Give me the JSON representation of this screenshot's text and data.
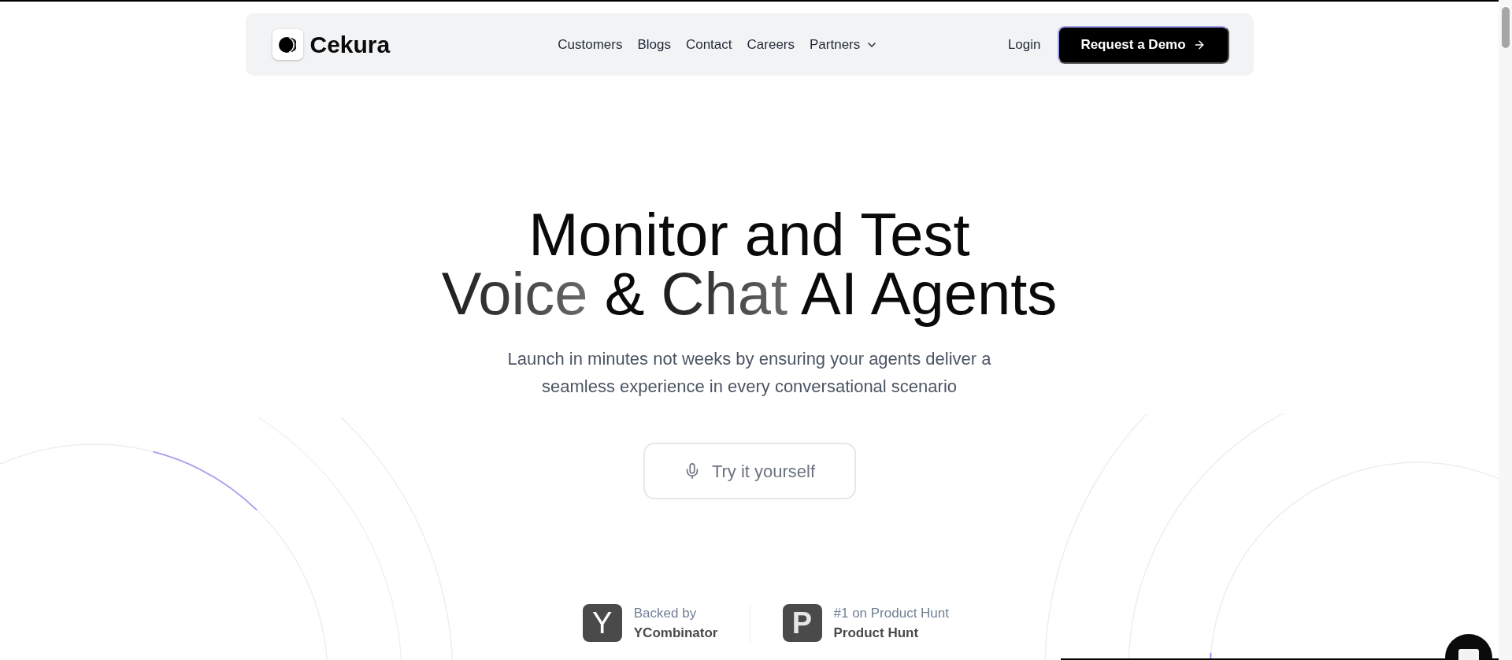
{
  "nav": {
    "logo": "Cekura",
    "links": [
      {
        "label": "Customers",
        "kind": "link"
      },
      {
        "label": "Blogs",
        "kind": "link"
      },
      {
        "label": "Contact",
        "kind": "link"
      },
      {
        "label": "Careers",
        "kind": "link"
      },
      {
        "label": "Partners",
        "kind": "dropdown"
      }
    ],
    "login": "Login",
    "cta": "Request a Demo"
  },
  "hero": {
    "heading": [
      [
        {
          "text": "Monitor and Test",
          "kind": "solid"
        }
      ],
      [
        {
          "text": "Voice",
          "kind": "gradient"
        },
        {
          "text": "&",
          "kind": "solid"
        },
        {
          "text": "Chat",
          "kind": "gradient"
        },
        {
          "text": "AI Agents",
          "kind": "solid"
        }
      ]
    ],
    "subtitle": "Launch in minutes not weeks by ensuring your agents deliver a seamless experience in every conversational scenario",
    "try_button": "Try it yourself"
  },
  "badges": [
    {
      "logo_letter": "Y",
      "caption": "Backed by",
      "name": "YCombinator"
    },
    {
      "logo_letter": "P",
      "caption": "#1 on Product Hunt",
      "name": "Product Hunt"
    }
  ]
}
